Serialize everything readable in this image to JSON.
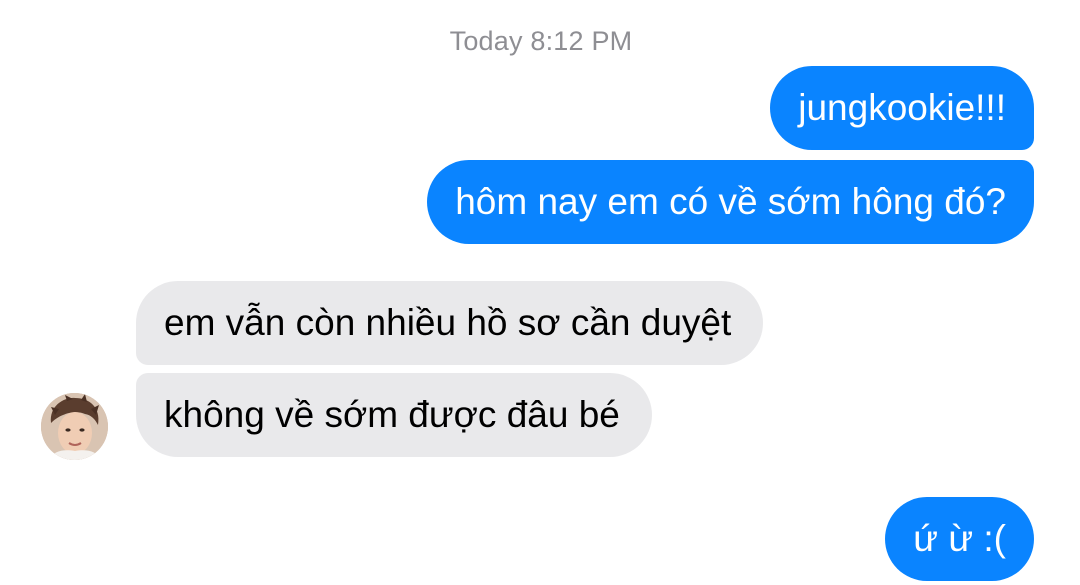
{
  "conversation": {
    "timestamp": "Today 8:12 PM",
    "messages": [
      {
        "sender": "me",
        "text": "jungkookie!!!"
      },
      {
        "sender": "me",
        "text": "hôm nay em có về sớm hông đó?"
      },
      {
        "sender": "other",
        "text": "em vẫn còn nhiều hồ sơ cần duyệt"
      },
      {
        "sender": "other",
        "text": "không về sớm được đâu bé"
      },
      {
        "sender": "me",
        "text": "ứ ừ :("
      }
    ],
    "avatar_icon": "contact-avatar-photo"
  },
  "colors": {
    "sent_bubble": "#0a84ff",
    "received_bubble": "#e9e9eb",
    "timestamp_text": "#8e8e93"
  }
}
